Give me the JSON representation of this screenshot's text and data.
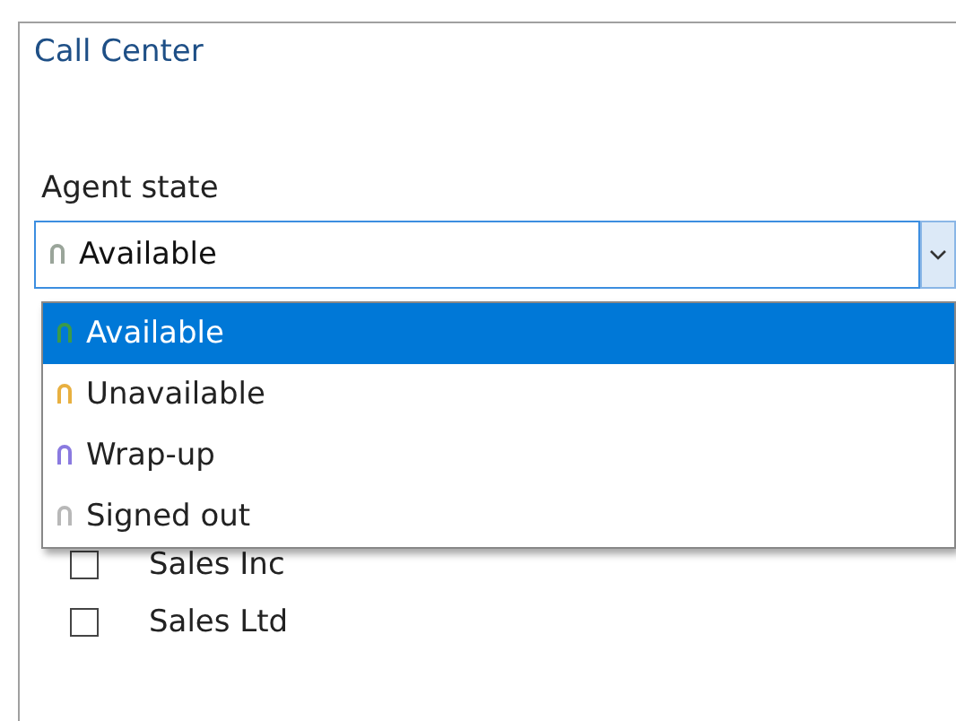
{
  "panel": {
    "title": "Call Center"
  },
  "agent_state": {
    "label": "Agent state",
    "value": "Available",
    "options": [
      {
        "label": "Available",
        "selected": true,
        "color": "#3a9a4a"
      },
      {
        "label": "Unavailable",
        "selected": false,
        "color": "#e8b040"
      },
      {
        "label": "Wrap-up",
        "selected": false,
        "color": "#8a7ae0"
      },
      {
        "label": "Signed out",
        "selected": false,
        "color": "#b8b8b8"
      }
    ]
  },
  "queues": [
    {
      "label": "Sales Inc",
      "checked": false
    },
    {
      "label": "Sales Ltd",
      "checked": false
    }
  ]
}
